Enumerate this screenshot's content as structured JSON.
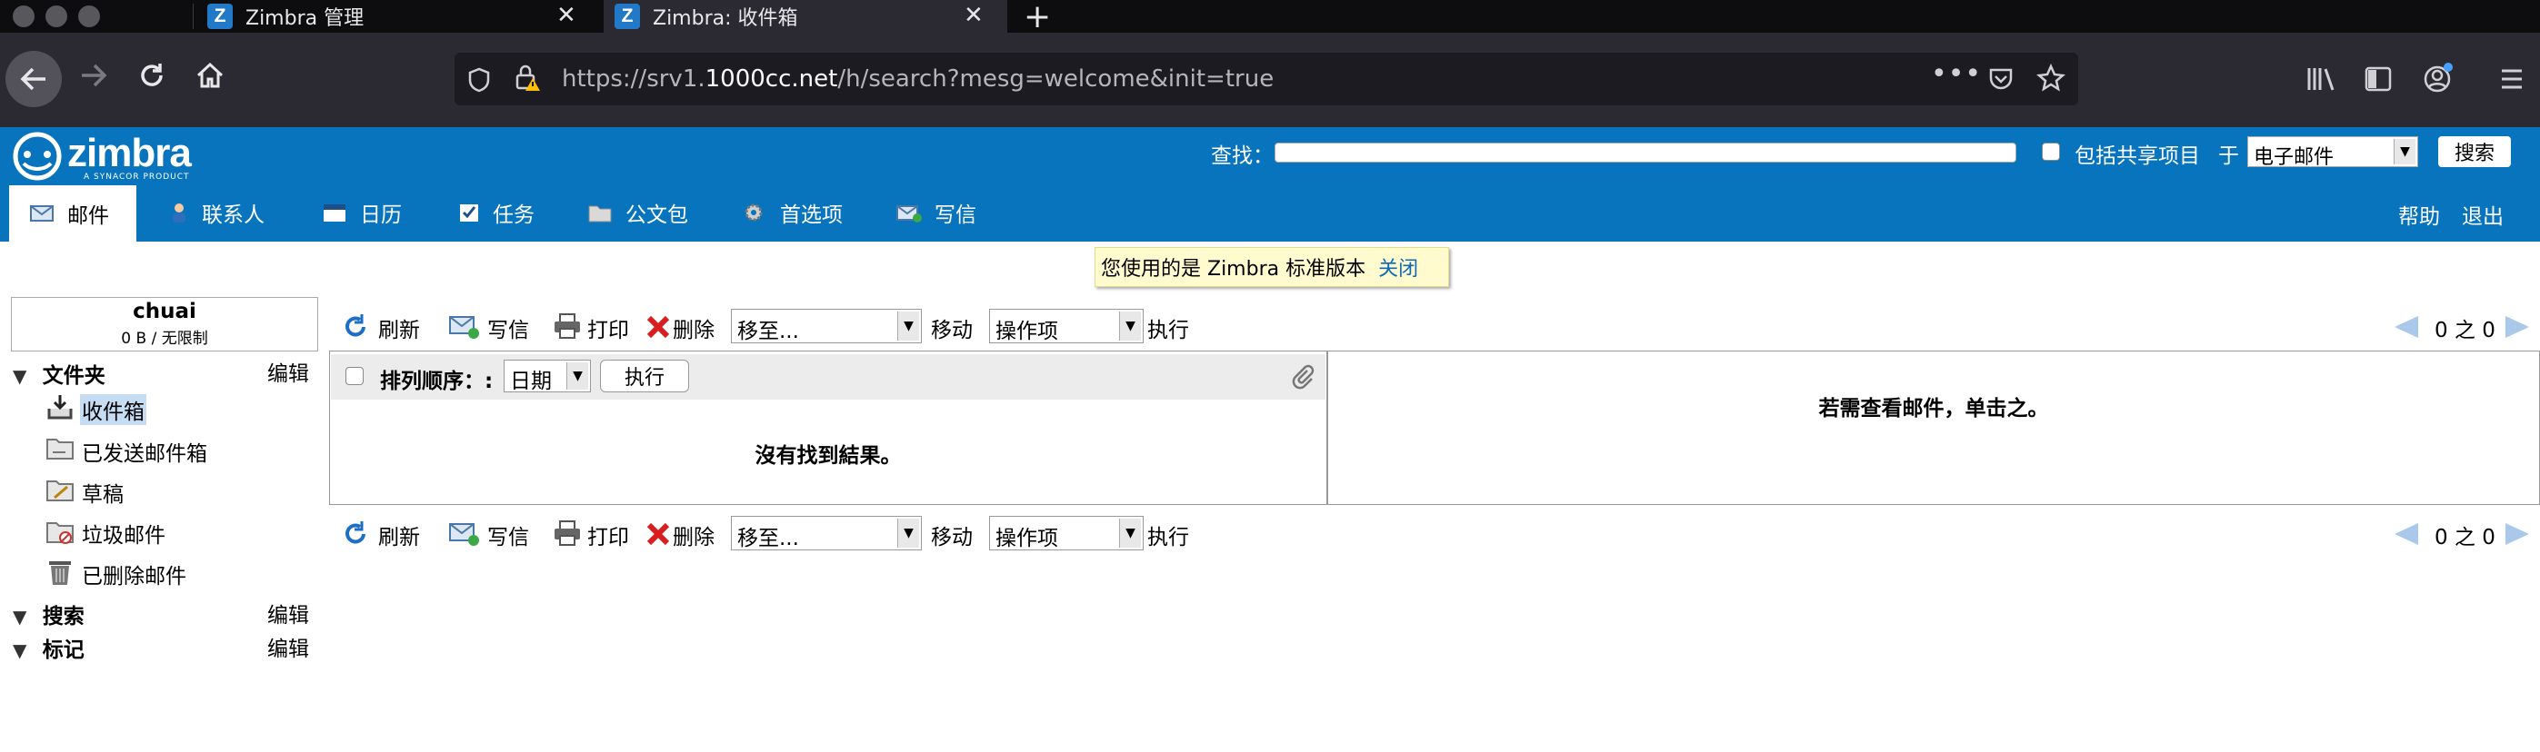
{
  "browser": {
    "tabs": [
      {
        "label": "Zimbra 管理",
        "icon": "zimbra-icon"
      },
      {
        "label": "Zimbra: 收件箱",
        "icon": "zimbra-icon"
      }
    ],
    "url_prefix": "https://srv1.",
    "url_domain": "1000cc.net",
    "url_path": "/h/search?mesg=welcome&init=true"
  },
  "header": {
    "logo_text": "zimbra",
    "logo_sub": "A SYNACOR PRODUCT",
    "search_label": "查找：",
    "include_shared_label": "包括共享项目",
    "in_label": "于",
    "search_type": "电子邮件",
    "search_button": "搜索",
    "help": "帮助",
    "logout": "退出"
  },
  "nav_tabs": [
    {
      "label": "邮件",
      "icon": "mail-icon",
      "active": true
    },
    {
      "label": "联系人",
      "icon": "contacts-icon"
    },
    {
      "label": "日历",
      "icon": "calendar-icon"
    },
    {
      "label": "任务",
      "icon": "tasks-icon"
    },
    {
      "label": "公文包",
      "icon": "briefcase-icon"
    },
    {
      "label": "首选项",
      "icon": "preferences-icon"
    },
    {
      "label": "写信",
      "icon": "compose-icon"
    }
  ],
  "notice": {
    "text": "您使用的是 Zimbra 标准版本",
    "close": "关闭"
  },
  "user": {
    "name": "chuai",
    "quota": "0 B / 无限制"
  },
  "sidebar": {
    "folders_title": "文件夹",
    "edit": "编辑",
    "folders": [
      {
        "label": "收件箱",
        "icon": "inbox-icon",
        "selected": true
      },
      {
        "label": "已发送邮件箱",
        "icon": "sent-icon"
      },
      {
        "label": "草稿",
        "icon": "drafts-icon"
      },
      {
        "label": "垃圾邮件",
        "icon": "junk-icon"
      },
      {
        "label": "已删除邮件",
        "icon": "trash-icon"
      }
    ],
    "search_title": "搜索",
    "tags_title": "标记"
  },
  "toolbar": {
    "refresh": "刷新",
    "compose": "写信",
    "print": "打印",
    "delete": "删除",
    "move_to": "移至...",
    "move": "移动",
    "actions": "操作项",
    "execute": "执行",
    "paging": "0 之 0"
  },
  "list": {
    "sort_label": "排列顺序：:",
    "sort_value": "日期",
    "execute": "执行",
    "empty": "沒有找到結果。"
  },
  "reading_pane": {
    "hint": "若需查看邮件，单击之。"
  },
  "colors": {
    "zimbra_blue": "#0774bd",
    "browser_dark": "#2b2a33"
  }
}
